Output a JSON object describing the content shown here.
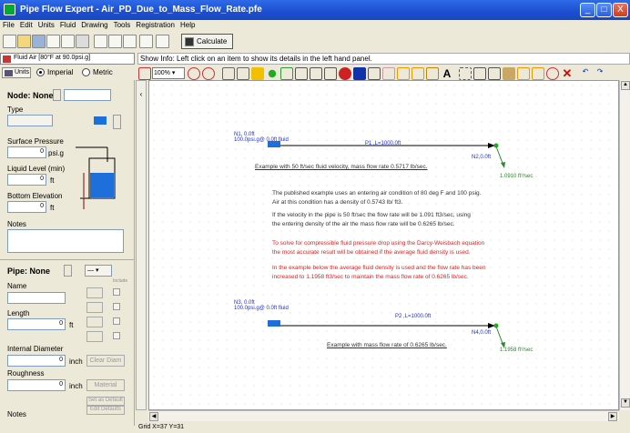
{
  "window": {
    "title": "Pipe Flow Expert - Air_PD_Due_to_Mass_Flow_Rate.pfe",
    "min": "_",
    "max": "□",
    "close": "X"
  },
  "menu": [
    "File",
    "Edit",
    "Units",
    "Fluid",
    "Drawing",
    "Tools",
    "Registration",
    "Help"
  ],
  "toolbar": {
    "calculate": "Calculate"
  },
  "fluid": {
    "label": "Fluid",
    "value": "Air [80°F at 90.0psi.g]"
  },
  "showinfo": "Show Info: Left click on an item to show its details in the left hand panel.",
  "units": {
    "label": "Units",
    "imperial": "Imperial",
    "metric": "Metric",
    "selected": "Imperial"
  },
  "zoom": "100%",
  "node_panel": {
    "title": "Node: None",
    "type_label": "Type",
    "surface_pressure_label": "Surface Pressure",
    "surface_pressure_value": "0",
    "surface_pressure_unit": "psi.g",
    "liquid_level_label": "Liquid Level (min)",
    "liquid_level_value": "0",
    "liquid_level_unit": "ft",
    "bottom_elevation_label": "Bottom Elevation",
    "bottom_elevation_value": "0",
    "bottom_elevation_unit": "ft",
    "notes_label": "Notes"
  },
  "pipe_panel": {
    "title": "Pipe: None",
    "name_label": "Name",
    "include_label": "Include",
    "length_label": "Length",
    "length_value": "0",
    "length_unit": "ft",
    "diameter_label": "Internal Diameter",
    "diameter_value": "0",
    "diameter_unit": "inch",
    "diameter_button": "Clear Diam",
    "roughness_label": "Roughness",
    "roughness_value": "0",
    "roughness_unit": "inch",
    "roughness_button": "Material",
    "notes_label": "Notes",
    "set_default": "Set as Default",
    "edit_defaults": "Edit Defaults"
  },
  "canvas": {
    "n1": "N1, 0.0ft",
    "n1_sub": "100.0psi.g@ 0.0ft fluid",
    "p1": "P1 ,L=1000.0ft",
    "n2": "N2,0.0ft",
    "flow1": "1.0910 ft³/sec",
    "ex1": "Example with 50 ft/sec fluid velocity, mass flow rate 0.5717 lb/sec.",
    "para1a": "The published example uses an entering air condition of 80 deg F and 100 psig.",
    "para1b": "Air at this condition has a density of 0.5743 lb/ ft3.",
    "para2a": "If the velocity in the pipe is 50 ft/sec the flow rate will be 1.091 ft3/sec, using",
    "para2b": "the entering density of the air the mass flow rate will be 0.6265 lb/sec.",
    "red1a": "To solve for compressible fluid pressure drop using the Darcy-Weisbach equation",
    "red1b": "the most accurate result will be obtained if the average fluid density is used.",
    "red2a": "In the example below the average fluid density is used and the flow rate has been",
    "red2b": "increased to 1.1958 ft3/sec to maintain the mass flow rate of 0.6265 lb/sec.",
    "n3": "N3, 0.0ft",
    "n3_sub": "100.0psi.g@ 0.0ft fluid",
    "p2": "P2 ,L=1000.0ft",
    "n4": "N4,0.0ft",
    "flow2": "1.1958 ft³/sec",
    "ex2": "Example with mass flow rate of 0.6265 lb/sec."
  },
  "status": "Grid X=37 Y=31",
  "colors": {
    "titlebar": "#1b4fd0",
    "canvas_text_blue": "#2030d0",
    "canvas_text_red": "#d22222",
    "flow_green": "#2a8a2a",
    "pipe": "#000000",
    "tank": "#1e6fd9"
  }
}
